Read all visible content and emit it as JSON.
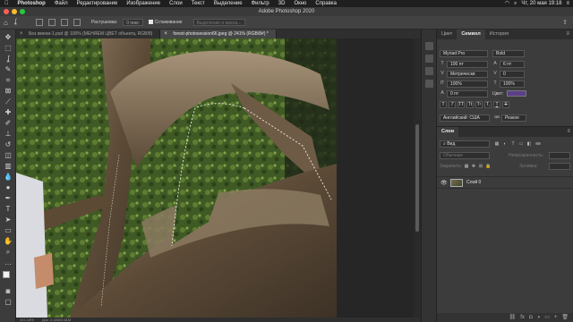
{
  "menubar": {
    "app": "Photoshop",
    "items": [
      "Файл",
      "Редактирование",
      "Изображение",
      "Слои",
      "Текст",
      "Выделение",
      "Фильтр",
      "3D",
      "Окно",
      "Справка"
    ],
    "clock": "Чт, 20 мая 19:18"
  },
  "window": {
    "title": "Adobe Photoshop 2020"
  },
  "options": {
    "feather_label": "Растушевка:",
    "feather_value": "0 пикс",
    "antialias_label": "Сглаживание",
    "select_mask_label": "Выделение и маска..."
  },
  "tabs": [
    {
      "label": "Без имени-1.psd @ 100% (МЕНЯЕМ ЦВЕТ объекта, RGB/8)"
    },
    {
      "label": "forest-photosession66.jpeg @ 241% (RGB/8#) *"
    }
  ],
  "status": {
    "zoom": "241,18%",
    "doc": "Док: 2,14M/3,61M"
  },
  "character_panel": {
    "tabs": [
      "Цвет",
      "Символ",
      "История"
    ],
    "font_family": "Myriad Pro",
    "font_style": "Bold",
    "font_size": "100 пт",
    "leading": "6 пт",
    "kerning": "Метрически",
    "tracking": "0",
    "vertical_scale": "100%",
    "horizontal_scale": "100%",
    "baseline": "0 пт",
    "color_label": "Цвет:",
    "color_value": "#5b3f8a",
    "format_buttons": [
      "T",
      "T",
      "TT",
      "Tt",
      "T¹",
      "T,",
      "T",
      "T"
    ],
    "language": "Английский: США",
    "aa_label": "aa",
    "antialias": "Резкое"
  },
  "layers_panel": {
    "title": "Слои",
    "filter_label": "Вид",
    "blend_mode": "Обычные",
    "opacity_label": "Непрозрачность:",
    "lock_label": "Закрепить:",
    "fill_label": "Заливка:",
    "layer_name": "Слой 0"
  }
}
